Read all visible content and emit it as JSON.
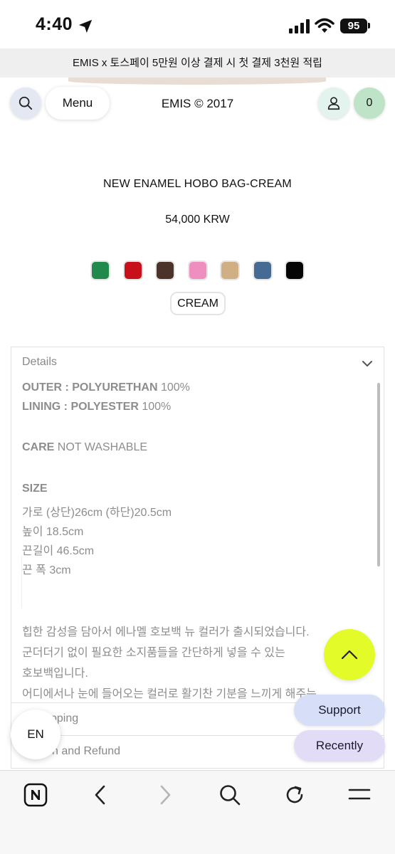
{
  "status_bar": {
    "time": "4:40",
    "battery": "95"
  },
  "promo": {
    "text": "EMIS x 토스페이 5만원 이상 결제 시 첫 결제 3천원 적립"
  },
  "header": {
    "menu_label": "Menu",
    "brand": "EMIS © 2017",
    "cart_count": "0"
  },
  "product": {
    "name": "NEW ENAMEL HOBO BAG-CREAM",
    "price": "54,000 KRW",
    "swatches": [
      {
        "name": "green",
        "color": "#1f8a4c"
      },
      {
        "name": "red",
        "color": "#c8101a"
      },
      {
        "name": "brown",
        "color": "#4b3329"
      },
      {
        "name": "pink",
        "color": "#ef8fc0"
      },
      {
        "name": "beige",
        "color": "#cfaf83"
      },
      {
        "name": "navy",
        "color": "#456b95"
      },
      {
        "name": "black",
        "color": "#050505"
      }
    ],
    "selected_color": "CREAM"
  },
  "details": {
    "title": "Details",
    "outer_label": "OUTER : POLYURETHAN",
    "outer_value": " 100%",
    "lining_label": "LINING : POLYESTER",
    "lining_value": " 100%",
    "care_label": "CARE",
    "care_value": " NOT WASHABLE",
    "size_label": "SIZE",
    "size_lines": [
      "가로 (상단)26cm (하단)20.5cm",
      "높이 18.5cm",
      "끈길이 46.5cm",
      "끈 폭 3cm"
    ],
    "description": [
      "힙한 감성을 담아서 에나멜 호보백 뉴 컬러가 출시되었습니다.",
      "군더더기 없이 필요한 소지품들을 간단하게 넣을 수 있는",
      "호보백입니다.",
      "어디에서나 눈에 들어오는 컬러로 활기찬 기분을 느끼게 해주는"
    ]
  },
  "sections": {
    "shipping_partial": "pping",
    "return_partial": "n and Refund"
  },
  "floating": {
    "support": "Support",
    "recently": "Recently",
    "language": "EN"
  }
}
